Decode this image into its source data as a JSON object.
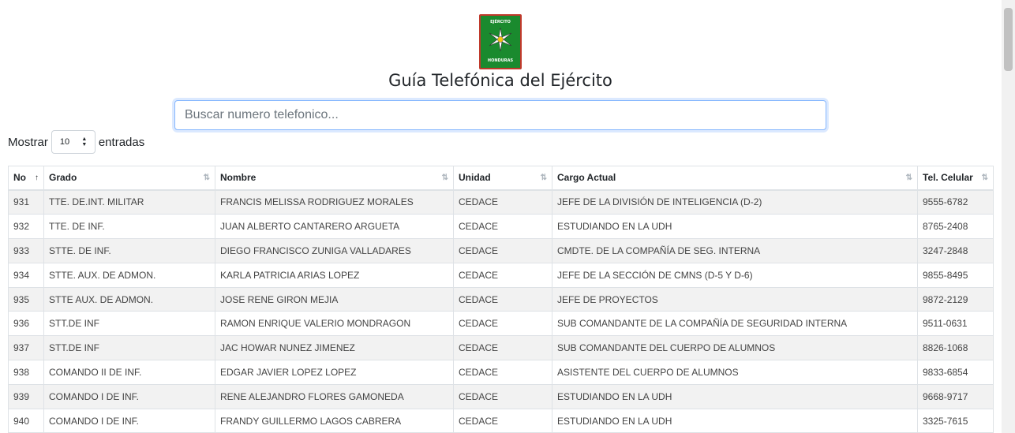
{
  "logo": {
    "top_text": "EJÉRCITO",
    "bottom_text": "HONDURAS",
    "icon": "star-emblem-icon"
  },
  "title": "Guía Telefónica del Ejército",
  "search": {
    "placeholder": "Buscar numero telefonico..."
  },
  "length_menu": {
    "prefix": "Mostrar",
    "value": "10",
    "suffix": "entradas"
  },
  "table": {
    "columns": [
      "No",
      "Grado",
      "Nombre",
      "Unidad",
      "Cargo Actual",
      "Tel. Celular"
    ],
    "rows": [
      [
        "931",
        "TTE. DE.INT. MILITAR",
        "FRANCIS MELISSA RODRIGUEZ MORALES",
        "CEDACE",
        "JEFE DE LA DIVISIÓN DE INTELIGENCIA (D-2)",
        "9555-6782"
      ],
      [
        "932",
        "TTE. DE INF.",
        "JUAN ALBERTO CANTARERO ARGUETA",
        "CEDACE",
        "ESTUDIANDO EN LA UDH",
        "8765-2408"
      ],
      [
        "933",
        "STTE. DE INF.",
        "DIEGO FRANCISCO ZUNIGA VALLADARES",
        "CEDACE",
        "CMDTE. DE LA COMPAÑÍA DE SEG. INTERNA",
        "3247-2848"
      ],
      [
        "934",
        "STTE. AUX. DE ADMON.",
        "KARLA PATRICIA ARIAS LOPEZ",
        "CEDACE",
        "JEFE DE LA SECCIÓN DE CMNS (D-5 Y D-6)",
        "9855-8495"
      ],
      [
        "935",
        "STTE AUX. DE ADMON.",
        "JOSE RENE GIRON MEJIA",
        "CEDACE",
        "JEFE DE PROYECTOS",
        "9872-2129"
      ],
      [
        "936",
        "STT.DE INF",
        "RAMON ENRIQUE VALERIO MONDRAGON",
        "CEDACE",
        "SUB COMANDANTE DE LA COMPAÑÍA DE SEGURIDAD INTERNA",
        "9511-0631"
      ],
      [
        "937",
        "STT.DE INF",
        "JAC HOWAR NUNEZ JIMENEZ",
        "CEDACE",
        "SUB COMANDANTE DEL CUERPO DE ALUMNOS",
        "8826-1068"
      ],
      [
        "938",
        "COMANDO II DE INF.",
        "EDGAR JAVIER LOPEZ LOPEZ",
        "CEDACE",
        "ASISTENTE DEL CUERPO DE ALUMNOS",
        "9833-6854"
      ],
      [
        "939",
        "COMANDO I DE INF.",
        "RENE ALEJANDRO FLORES GAMONEDA",
        "CEDACE",
        "ESTUDIANDO EN LA UDH",
        "9668-9717"
      ],
      [
        "940",
        "COMANDO I DE INF.",
        "FRANDY GUILLERMO LAGOS CABRERA",
        "CEDACE",
        "ESTUDIANDO EN LA UDH",
        "3325-7615"
      ]
    ]
  }
}
